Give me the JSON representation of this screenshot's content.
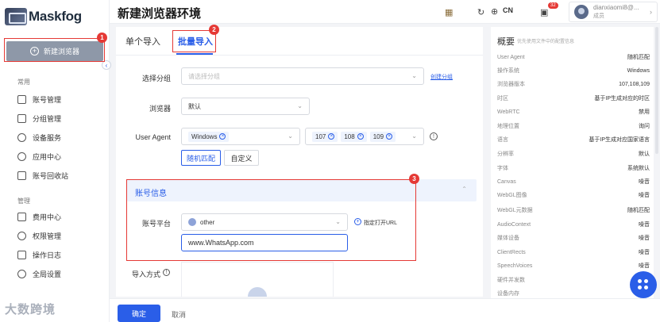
{
  "app": {
    "logo_text": "Maskfog",
    "watermark": "大数跨境"
  },
  "sidebar": {
    "new_browser_label": "新建浏览器",
    "collapse_glyph": "‹",
    "section_common": "常用",
    "section_manage": "管理",
    "common_items": [
      {
        "label": "账号管理",
        "icon": "folder-icon"
      },
      {
        "label": "分组管理",
        "icon": "group-folder-icon"
      },
      {
        "label": "设备服务",
        "icon": "location-pin-icon"
      },
      {
        "label": "应用中心",
        "icon": "app-circle-icon"
      },
      {
        "label": "账号回收站",
        "icon": "trash-icon"
      }
    ],
    "manage_items": [
      {
        "label": "费用中心",
        "icon": "yen-icon"
      },
      {
        "label": "权限管理",
        "icon": "shield-icon"
      },
      {
        "label": "操作日志",
        "icon": "clipboard-icon"
      },
      {
        "label": "全局设置",
        "icon": "settings-circle-icon"
      }
    ]
  },
  "annotations": {
    "badge1": "1",
    "badge2": "2",
    "badge3": "3"
  },
  "header": {
    "title": "新建浏览器环境",
    "language": "CN",
    "notification_count": "32",
    "user_name": "dianxiaomi8@...",
    "user_role": "成员",
    "user_chevron": "›"
  },
  "tabs": {
    "single": "单个导入",
    "batch": "批量导入"
  },
  "form": {
    "group_label": "选择分组",
    "group_placeholder": "请选择分组",
    "create_group_link": "创建分组",
    "browser_label": "浏览器",
    "browser_value": "默认",
    "ua_label": "User Agent",
    "os_tag": "Windows",
    "versions": [
      "107",
      "108",
      "109"
    ],
    "ua_random": "随机匹配",
    "ua_custom": "自定义",
    "account_section_title": "账号信息",
    "platform_label": "账号平台",
    "platform_value": "other",
    "open_url_label": "指定打开URL",
    "url_value": "www.WhatsApp.com",
    "import_method_label": "导入方式"
  },
  "footer": {
    "ok_label": "确定",
    "cancel_label": "取消"
  },
  "summary": {
    "title": "概要",
    "subtitle": "优先使用文件中的配置信息",
    "rows": [
      {
        "k": "User Agent",
        "v": "随机匹配"
      },
      {
        "k": "操作系统",
        "v": "Windows"
      },
      {
        "k": "浏览器版本",
        "v": "107,108,109"
      },
      {
        "k": "时区",
        "v": "基于IP生成对应的时区"
      },
      {
        "k": "WebRTC",
        "v": "禁用"
      },
      {
        "k": "地理位置",
        "v": "询问"
      },
      {
        "k": "语言",
        "v": "基于IP生成对应国家语言"
      },
      {
        "k": "分辨率",
        "v": "默认"
      },
      {
        "k": "字体",
        "v": "系统默认"
      },
      {
        "k": "Canvas",
        "v": "噪音"
      },
      {
        "k": "WebGL图像",
        "v": "噪音"
      },
      {
        "k": "WebGL元数据",
        "v": "随机匹配"
      },
      {
        "k": "AudioContext",
        "v": "噪音"
      },
      {
        "k": "媒体设备",
        "v": "噪音"
      },
      {
        "k": "ClientRects",
        "v": "噪音"
      },
      {
        "k": "SpeechVoices",
        "v": "噪音"
      },
      {
        "k": "硬件并发数",
        "v": ""
      },
      {
        "k": "设备内存",
        "v": ""
      }
    ]
  }
}
